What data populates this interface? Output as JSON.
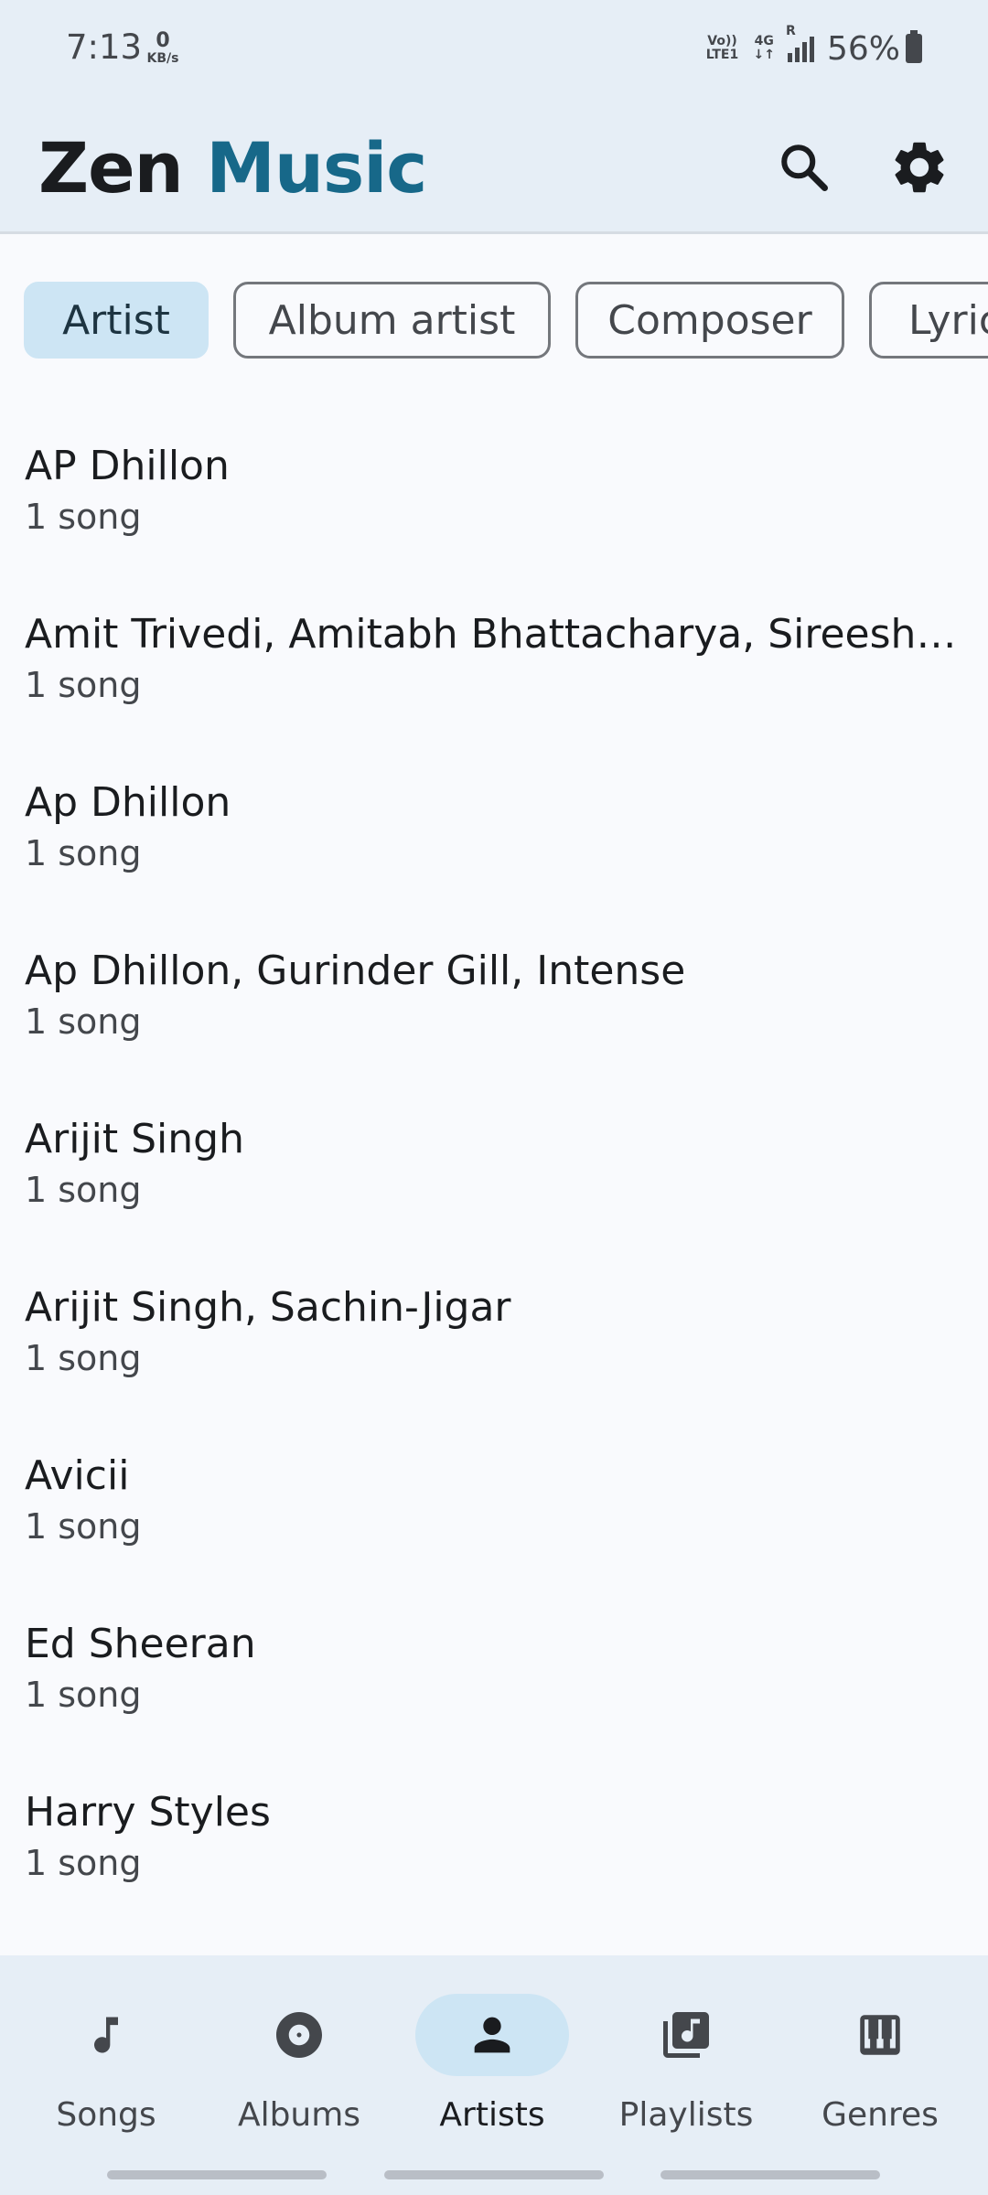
{
  "status": {
    "time": "7:13",
    "speed_value": "0",
    "speed_unit": "KB/s",
    "volte": "Vo)) LTE1",
    "network": "4G",
    "roaming": "R",
    "battery": "56%"
  },
  "appbar": {
    "title_part1": "Zen",
    "title_part2": "Music"
  },
  "chips": [
    {
      "label": "Artist",
      "selected": true
    },
    {
      "label": "Album artist",
      "selected": false
    },
    {
      "label": "Composer",
      "selected": false
    },
    {
      "label": "Lyricist",
      "selected": false
    }
  ],
  "artists": [
    {
      "name": "AP Dhillon",
      "count": "1 song"
    },
    {
      "name": "Amit Trivedi, Amitabh Bhattacharya, Sireesha Bhagavatula",
      "count": "1 song"
    },
    {
      "name": "Ap Dhillon",
      "count": "1 song"
    },
    {
      "name": "Ap Dhillon, Gurinder Gill, Intense",
      "count": "1 song"
    },
    {
      "name": "Arijit Singh",
      "count": "1 song"
    },
    {
      "name": "Arijit Singh, Sachin-Jigar",
      "count": "1 song"
    },
    {
      "name": "Avicii",
      "count": "1 song"
    },
    {
      "name": "Ed Sheeran",
      "count": "1 song"
    },
    {
      "name": "Harry Styles",
      "count": "1 song"
    }
  ],
  "nav": {
    "items": [
      {
        "label": "Songs",
        "icon": "music-note-icon"
      },
      {
        "label": "Albums",
        "icon": "disc-icon"
      },
      {
        "label": "Artists",
        "icon": "person-icon",
        "active": true
      },
      {
        "label": "Playlists",
        "icon": "playlist-icon"
      },
      {
        "label": "Genres",
        "icon": "piano-icon"
      }
    ]
  },
  "colors": {
    "accent": "#176889",
    "surface": "#e6eef6",
    "background": "#f9fafd",
    "selected_chip": "#cde5f4"
  }
}
